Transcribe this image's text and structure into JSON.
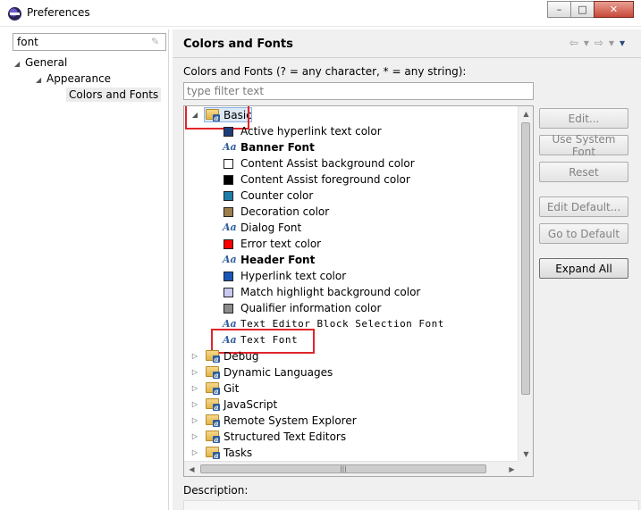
{
  "window": {
    "title": "Preferences",
    "min": "–",
    "max": "□",
    "close": "✕"
  },
  "left": {
    "search_value": "font",
    "tree": [
      {
        "label": "General",
        "level": 0,
        "state": "expanded"
      },
      {
        "label": "Appearance",
        "level": 1,
        "state": "expanded"
      },
      {
        "label": "Colors and Fonts",
        "level": 2,
        "state": "leaf",
        "selected": true
      }
    ]
  },
  "page": {
    "title": "Colors and Fonts",
    "instruction": "Colors and Fonts (? = any character, * = any string):",
    "filter_placeholder": "type filter text",
    "description_label": "Description:"
  },
  "tree": {
    "basic": {
      "label": "Basic",
      "state": "expanded"
    },
    "basic_children": [
      {
        "label": "Active hyperlink text color",
        "kind": "color",
        "color": "#1f3d7a"
      },
      {
        "label": "Banner Font",
        "kind": "font",
        "style": "bold"
      },
      {
        "label": "Content Assist background color",
        "kind": "color",
        "color": "#ffffff"
      },
      {
        "label": "Content Assist foreground color",
        "kind": "color",
        "color": "#000000"
      },
      {
        "label": "Counter color",
        "kind": "color",
        "color": "#1f7ea8"
      },
      {
        "label": "Decoration color",
        "kind": "color",
        "color": "#9c7f4c"
      },
      {
        "label": "Dialog Font",
        "kind": "font",
        "style": "normal"
      },
      {
        "label": "Error text color",
        "kind": "color",
        "color": "#ff0000"
      },
      {
        "label": "Header Font",
        "kind": "font",
        "style": "bold"
      },
      {
        "label": "Hyperlink text color",
        "kind": "color",
        "color": "#1a56b8"
      },
      {
        "label": "Match highlight background color",
        "kind": "color",
        "color": "#c8c8f0"
      },
      {
        "label": "Qualifier information color",
        "kind": "color",
        "color": "#8c8c8c"
      },
      {
        "label": "Text Editor Block Selection Font",
        "kind": "font",
        "style": "mono"
      },
      {
        "label": "Text Font",
        "kind": "font",
        "style": "mono"
      }
    ],
    "other_categories": [
      {
        "label": "Debug",
        "state": "collapsed"
      },
      {
        "label": "Dynamic Languages",
        "state": "collapsed"
      },
      {
        "label": "Git",
        "state": "collapsed"
      },
      {
        "label": "JavaScript",
        "state": "collapsed"
      },
      {
        "label": "Remote System Explorer",
        "state": "collapsed"
      },
      {
        "label": "Structured Text Editors",
        "state": "collapsed"
      },
      {
        "label": "Tasks",
        "state": "collapsed"
      }
    ]
  },
  "buttons": {
    "edit": "Edit...",
    "use_system_font": "Use System Font",
    "reset": "Reset",
    "edit_default": "Edit Default...",
    "go_to_default": "Go to Default",
    "expand_all": "Expand All"
  },
  "icons": {
    "back": "⇦",
    "forward": "⇨",
    "menu": "▾",
    "font_glyph": "Aa"
  },
  "colors": {
    "highlight_outline": "#e0252b",
    "selection_bg": "#dde8f5"
  }
}
